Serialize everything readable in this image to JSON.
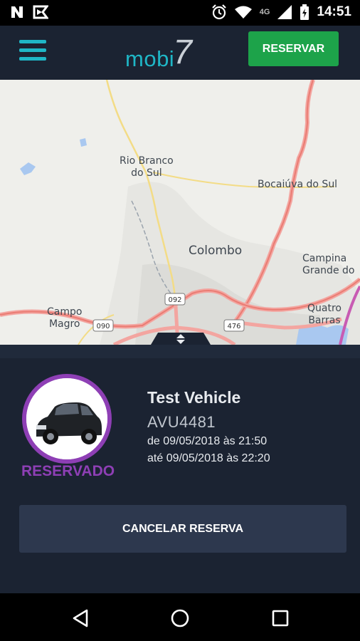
{
  "status_bar": {
    "time": "14:51",
    "network": "4G",
    "icons": [
      "notification-n-icon",
      "notification-flag-icon",
      "alarm-icon",
      "wifi-icon",
      "signal-icon",
      "battery-icon"
    ]
  },
  "app_bar": {
    "menu_icon": "hamburger-menu-icon",
    "logo_text": "mobi",
    "logo_number": "7",
    "reserve_label": "RESERVAR",
    "colors": {
      "background": "#1b2332",
      "accent": "#1fb6c6",
      "reserve_button": "#1da34a"
    }
  },
  "map": {
    "labels": [
      {
        "name": "rio-branco",
        "text": "Rio Branco\ndo Sul"
      },
      {
        "name": "bocaiuva",
        "text": "Bocaiúva do Sul"
      },
      {
        "name": "colombo",
        "text": "Colombo"
      },
      {
        "name": "campina",
        "text": "Campina\nGrande do"
      },
      {
        "name": "campo-magro",
        "text": "Campo\nMagro"
      },
      {
        "name": "quatro-barras",
        "text": "Quatro\nBarras"
      }
    ],
    "road_shields": [
      "092",
      "090",
      "476"
    ]
  },
  "reservation": {
    "status": "RESERVADO",
    "vehicle_name": "Test Vehicle",
    "plate": "AVU4481",
    "start": "de 09/05/2018 às 21:50",
    "end": "até 09/05/2018 às 22:20",
    "cancel_label": "CANCELAR RESERVA",
    "colors": {
      "status": "#8e3fb5",
      "panel": "#1b2332",
      "cancel_button": "#2d384e"
    }
  },
  "nav_bar": {
    "icons": [
      "back-icon",
      "home-icon",
      "recents-icon"
    ]
  }
}
